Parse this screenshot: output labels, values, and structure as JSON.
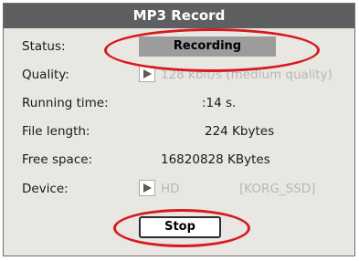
{
  "dialog": {
    "title": "MP3 Record",
    "status": {
      "label": "Status:",
      "value": "Recording"
    },
    "quality": {
      "label": "Quality:",
      "value": "128 kbit/s (medium quality)"
    },
    "running_time": {
      "label": "Running time:",
      "value": ":14 s."
    },
    "file_length": {
      "label": "File length:",
      "value": "224 Kbytes"
    },
    "free_space": {
      "label": "Free space:",
      "value": "16820828 KBytes"
    },
    "device": {
      "label": "Device:",
      "value": "HD",
      "volume": "[KORG_SSD]"
    },
    "stop_label": "Stop"
  },
  "colors": {
    "title_bar": "#5d5f60",
    "panel": "#e9e7e1",
    "status_box": "#9c9c9c",
    "disabled_text": "#b7b7b7",
    "annotation": "#d71920"
  },
  "icons": [
    "play-arrow-icon"
  ]
}
